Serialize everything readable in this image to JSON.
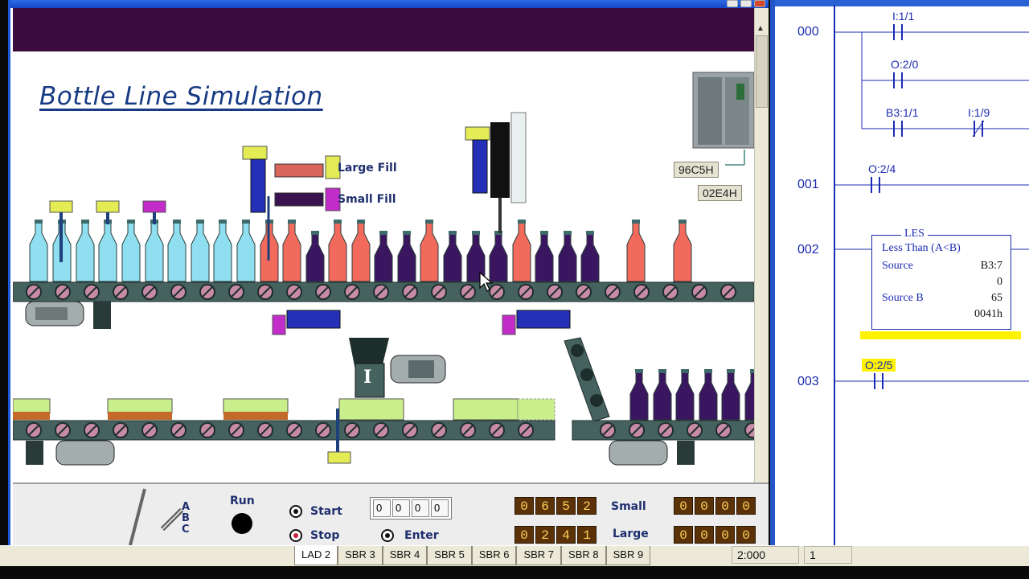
{
  "simulation": {
    "title": "Bottle Line Simulation",
    "fill_labels": {
      "large": "Large Fill",
      "small": "Small Fill"
    },
    "hex_values": [
      "96C5H",
      "02E4H"
    ],
    "run_label": "Run",
    "abc_label": "A B C",
    "controls": {
      "start_label": "Start",
      "stop_label": "Stop",
      "enter_label": "Enter"
    },
    "thumbwheel": [
      "0",
      "0",
      "0",
      "0"
    ],
    "counters": {
      "small": {
        "label": "Small",
        "digits": [
          "0",
          "6",
          "5",
          "2"
        ],
        "right_digits": [
          "0",
          "0",
          "0",
          "0"
        ]
      },
      "large": {
        "label": "Large",
        "digits": [
          "0",
          "2",
          "4",
          "1"
        ],
        "right_digits": [
          "0",
          "0",
          "0",
          "0"
        ]
      }
    }
  },
  "ladder": {
    "rungs": [
      {
        "number": "000",
        "addresses": [
          "I:1/1",
          "O:2/0",
          "B3:1/1",
          "I:1/9"
        ]
      },
      {
        "number": "001",
        "addresses": [
          "O:2/4"
        ]
      },
      {
        "number": "002",
        "instruction": {
          "mnemonic": "LES",
          "name": "Less Than (A<B)",
          "source_label": "Source",
          "source": "B3:7",
          "source_value": "0",
          "source_b_label": "Source B",
          "source_b": "65",
          "source_b_hex": "0041h"
        }
      },
      {
        "number": "003",
        "addresses": [
          "O:2/5"
        ]
      }
    ]
  },
  "statusbar": {
    "tabs": [
      "LAD 2",
      "SBR 3",
      "SBR 4",
      "SBR 5",
      "SBR 6",
      "SBR 7",
      "SBR 8",
      "SBR 9"
    ],
    "active_tab": "LAD 2",
    "position": "2:000",
    "value": "1"
  },
  "colors": {
    "banner": "#3b0b3d",
    "conveyor": "#45625f",
    "bottle_empty": "#8fdff0",
    "bottle_red": "#f26a5c",
    "bottle_purple": "#3a1560",
    "ladder_ink": "#1b2bb3",
    "highlight": "#fff200"
  }
}
